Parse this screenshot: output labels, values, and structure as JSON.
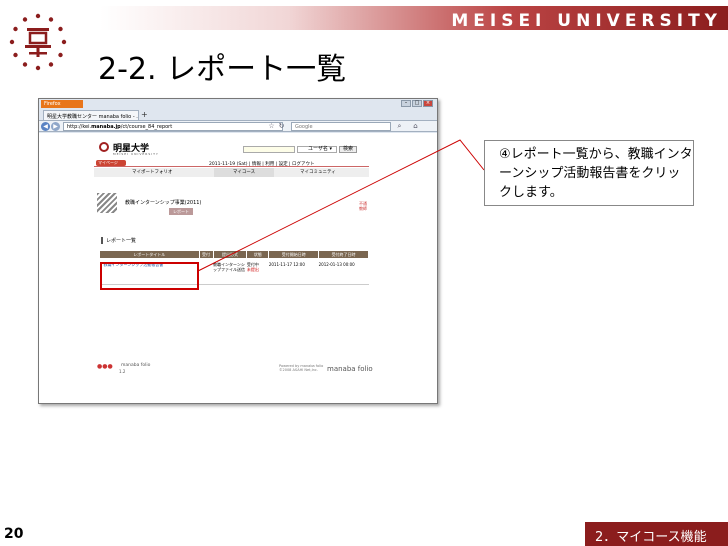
{
  "slide": {
    "university": "MEISEI UNIVERSITY",
    "title": "2-2. レポート一覧",
    "page_number": "20",
    "footer_section": "2．マイコース機能",
    "callout_text": "④レポート一覧から、教職インターンシップ活動報告書をクリックします。"
  },
  "browser": {
    "app_button": "Firefox",
    "tab_title": "明星大学教職センター manaba folio - ...",
    "url_prefix": "http://kei.",
    "url_domain": "manaba.jp",
    "url_path": "/ct/course_84_report",
    "search_placeholder": "Google"
  },
  "site": {
    "logo_text": "明星大学",
    "logo_sub": "MEISEI UNIVERSITY",
    "username_select": "ユーザ名",
    "search_button": "検索",
    "mypage_tab": "マイページ",
    "date_line": "2011-11-19 (Sat) | 情報 | 利用 | 設定 | ログアウト",
    "subnav": {
      "portfolio": "マイポートフォリオ",
      "courses": "マイコース",
      "community": "マイコミュニティ"
    },
    "course_title": "教職インターンシップ事業(2011)",
    "report_button": "レポート",
    "course_side_1": "不通",
    "course_side_2": "教師",
    "section_title": "レポート一覧"
  },
  "reports_table": {
    "headers": [
      "レポートタイトル",
      "受付",
      "提出形式",
      "状態",
      "受付開始日時",
      "受付終了日時"
    ],
    "rows": [
      {
        "title": "教職インターンシップ活動報告書",
        "reception": "",
        "format": "教職インターンシップファイル送信",
        "state_1": "受付中",
        "state_2": "未提出",
        "start": "2011-11-17 12:00",
        "end": "2012-01-13 00:00"
      }
    ]
  },
  "footer": {
    "folio_name": "manaba folio",
    "folio_version": "1.2",
    "powered_1": "Powered by manaba folio",
    "powered_2": "©2008 ASAHI Net,Inc.",
    "powered_logo": "manaba folio"
  },
  "colors": {
    "brand_red": "#8b1d1d",
    "highlight_red": "#cc0000"
  }
}
